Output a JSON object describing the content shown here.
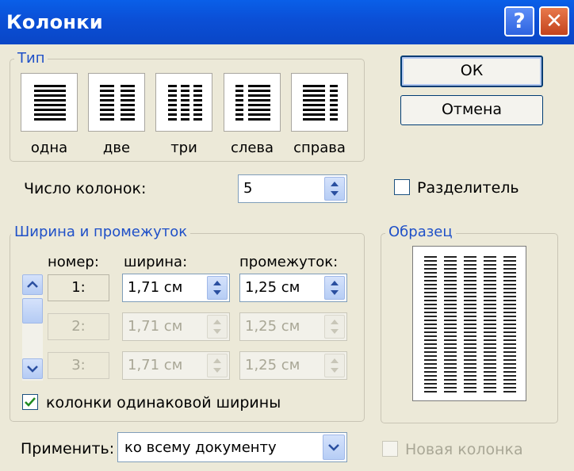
{
  "window": {
    "title": "Колонки"
  },
  "titlebar_buttons": {
    "help": "?",
    "close": "✕"
  },
  "buttons": {
    "ok": "ОК",
    "cancel": "Отмена"
  },
  "type_group": {
    "label": "Тип",
    "options": [
      {
        "label": "одна",
        "icon": "one-column-icon"
      },
      {
        "label": "две",
        "icon": "two-columns-icon"
      },
      {
        "label": "три",
        "icon": "three-columns-icon"
      },
      {
        "label": "слева",
        "icon": "left-column-icon"
      },
      {
        "label": "справа",
        "icon": "right-column-icon"
      }
    ]
  },
  "column_count": {
    "label": "Число колонок:",
    "value": "5"
  },
  "separator": {
    "label": "Разделитель",
    "checked": false
  },
  "width_group": {
    "label": "Ширина и промежуток",
    "headers": {
      "number": "номер:",
      "width": "ширина:",
      "spacing": "промежуток:"
    },
    "rows": [
      {
        "number": "1:",
        "width": "1,71 см",
        "spacing": "1,25 см",
        "enabled": true
      },
      {
        "number": "2:",
        "width": "1,71 см",
        "spacing": "1,25 см",
        "enabled": false
      },
      {
        "number": "3:",
        "width": "1,71 см",
        "spacing": "1,25 см",
        "enabled": false
      }
    ]
  },
  "equal_width": {
    "label": "колонки одинаковой ширины",
    "checked": true
  },
  "preview_group": {
    "label": "Образец",
    "columns": 5
  },
  "apply": {
    "label": "Применить:",
    "value": "ко всему документу"
  },
  "new_column": {
    "label": "Новая колонка",
    "checked": false,
    "enabled": false
  },
  "colors": {
    "title_bar": "#0a50d8",
    "dialog_bg": "#ece9d8",
    "group_label": "#1f50c8",
    "disabled_text": "#a9a796"
  }
}
